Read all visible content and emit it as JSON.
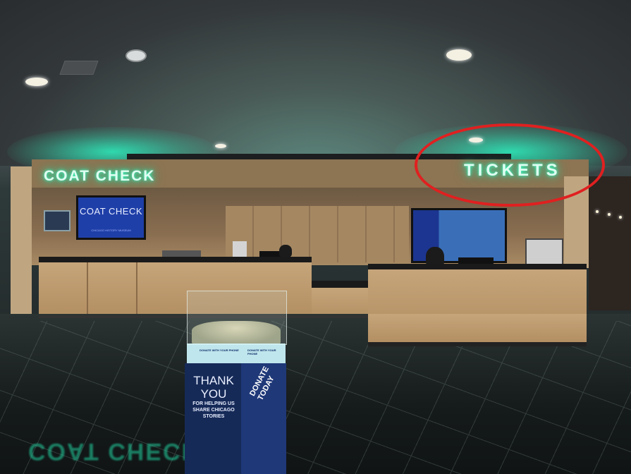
{
  "signs": {
    "coat_check": "COAT CHECK",
    "tickets": "TICKETS",
    "floor_reflection": "COAT CHECK"
  },
  "screens": {
    "coat_check_screen": "COAT CHECK",
    "coat_check_screen_sub": "CHICAGO HISTORY MUSEUM"
  },
  "donation_box": {
    "thank_you": "THANK YOU",
    "helping": "FOR HELPING US SHARE CHICAGO STORIES",
    "donate": "DONATE TODAY",
    "label_left": "DONATE WITH YOUR PHONE",
    "label_right": "DONATE WITH YOUR PHONE"
  },
  "annotation": {
    "color": "#e02020",
    "shape": "ellipse",
    "target": "tickets-sign"
  },
  "colors": {
    "neon": "#3affc4",
    "wood": "#b38f63",
    "screen": "#1f3fa8",
    "pedestal": "#162a58"
  }
}
